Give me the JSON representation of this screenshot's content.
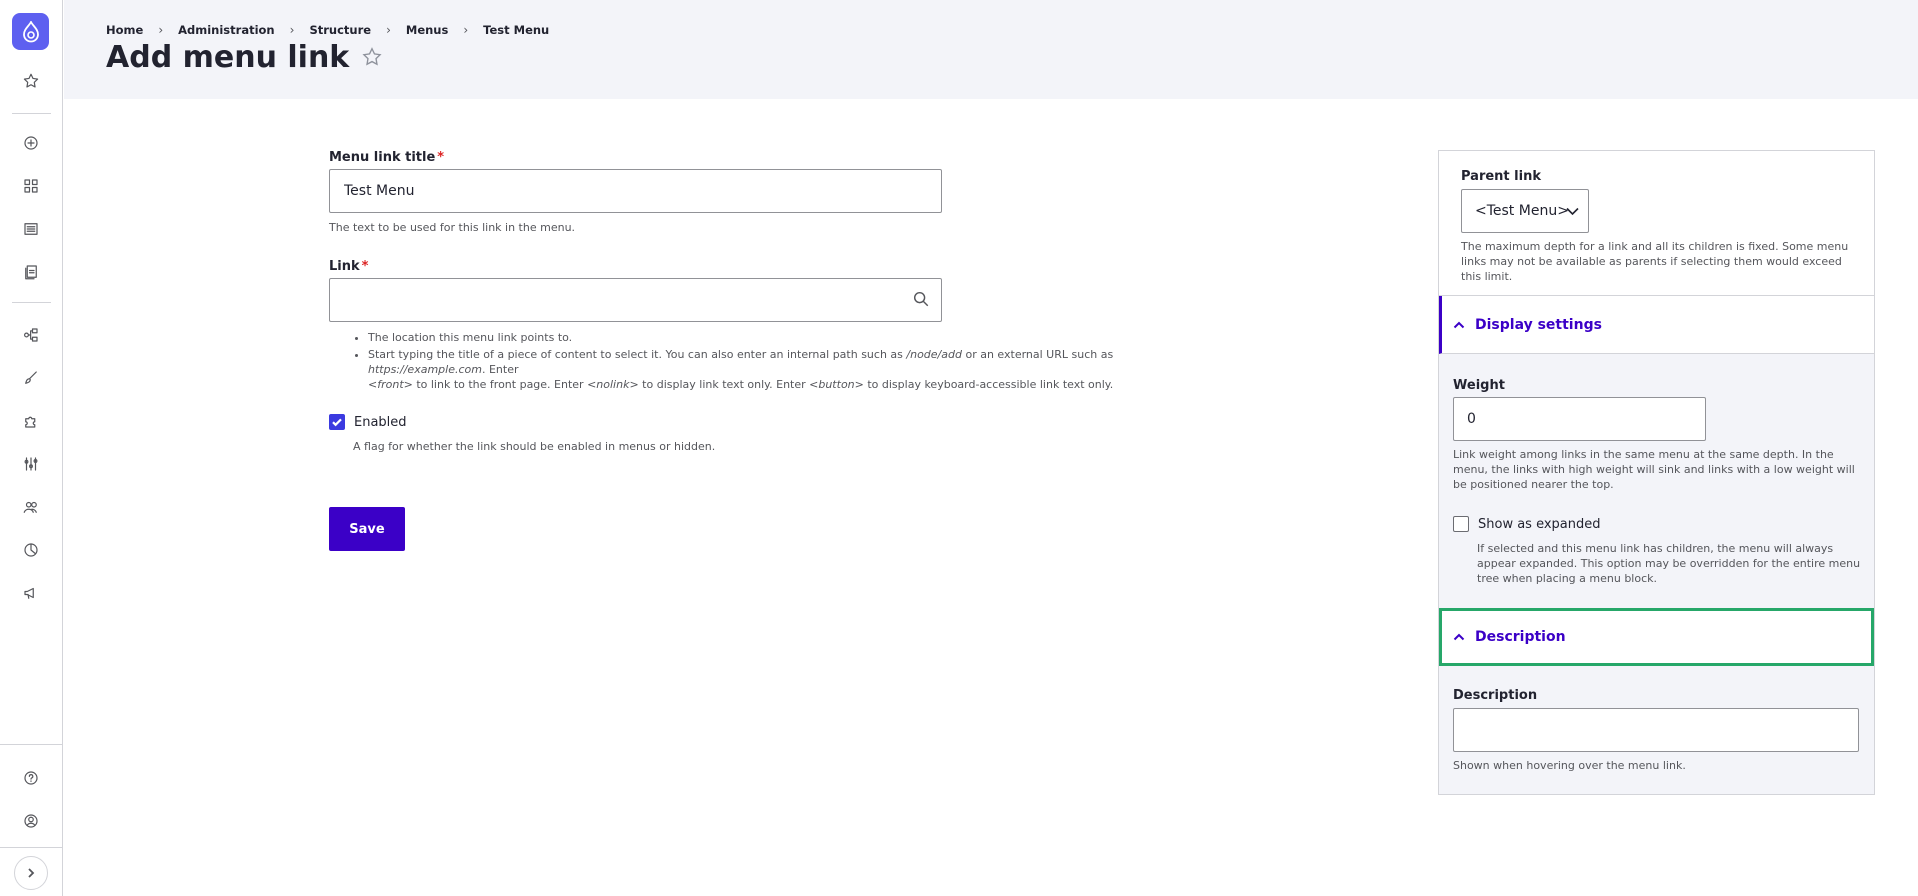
{
  "toolbar": {
    "icons": [
      "drupal-logo-icon",
      "star-icon",
      "plus-circle-icon",
      "grid-icon",
      "list-icon",
      "files-icon",
      "structure-icon",
      "brush-icon",
      "puzzle-icon",
      "sliders-icon",
      "people-icon",
      "chart-icon",
      "megaphone-icon",
      "help-icon",
      "user-icon",
      "chevron-right-icon"
    ]
  },
  "header": {
    "breadcrumb": [
      "Home",
      "Administration",
      "Structure",
      "Menus",
      "Test Menu"
    ],
    "breadcrumb_sep": "›",
    "title": "Add menu link"
  },
  "form": {
    "title_label": "Menu link title",
    "required_mark": "*",
    "title_value": "Test Menu",
    "title_desc": "The text to be used for this link in the menu.",
    "link_label": "Link",
    "link_value": "",
    "link_help_1": "The location this menu link points to.",
    "link_help_2a": "Start typing the title of a piece of content to select it. You can also enter an internal path such as ",
    "link_help_2b": "/node/add",
    "link_help_2c": " or an external URL such as ",
    "link_help_2d": "https://example.com",
    "link_help_2e": ". Enter",
    "link_help_3a": "<front>",
    "link_help_3b": " to link to the front page. Enter ",
    "link_help_3c": "<nolink>",
    "link_help_3d": " to display link text only. Enter ",
    "link_help_3e": "<button>",
    "link_help_3f": " to display keyboard-accessible link text only.",
    "enabled_label": "Enabled",
    "enabled_checked": true,
    "enabled_desc": "A flag for whether the link should be enabled in menus or hidden.",
    "save_label": "Save"
  },
  "sidebar": {
    "parent_label": "Parent link",
    "parent_value": "<Test Menu>",
    "parent_desc": "The maximum depth for a link and all its children is fixed. Some menu links may not be available as parents if selecting them would exceed this limit.",
    "display_settings_label": "Display settings",
    "weight_label": "Weight",
    "weight_value": "0",
    "weight_desc": "Link weight among links in the same menu at the same depth. In the menu, the links with high weight will sink and links with a low weight will be positioned nearer the top.",
    "expanded_label": "Show as expanded",
    "expanded_checked": false,
    "expanded_desc": "If selected and this menu link has children, the menu will always appear expanded. This option may be overridden for the entire menu tree when placing a menu block.",
    "description_section_label": "Description",
    "description_label": "Description",
    "description_value": "",
    "description_desc": "Shown when hovering over the menu link."
  },
  "colors": {
    "accent": "#3b00c7",
    "focus": "#26a769",
    "required": "#dc2323",
    "logo": "#5e60f0"
  }
}
